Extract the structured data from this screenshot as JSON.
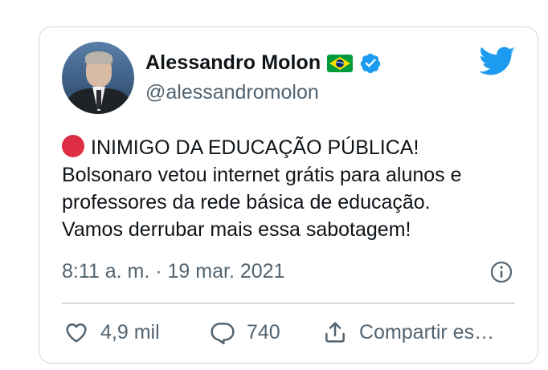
{
  "tweet": {
    "author": {
      "display_name": "Alessandro Molon",
      "handle": "@alessandromolon",
      "flag": "brazil-flag-emoji",
      "verified": true
    },
    "text_lines": [
      "INIMIGO DA EDUCAÇÃO PÚBLICA!",
      "Bolsonaro vetou internet grátis para alunos e",
      "professores da rede básica de educação.",
      "Vamos derrubar mais essa sabotagem!"
    ],
    "leading_emoji": "red-circle",
    "timestamp": "8:11 a. m. · 19 mar. 2021",
    "actions": {
      "likes": "4,9 mil",
      "replies": "740",
      "share": "Compartir es…"
    }
  },
  "colors": {
    "twitter_blue": "#1d9bf0",
    "text_primary": "#0f1419",
    "text_secondary": "#536471",
    "border": "#cfd9de",
    "red_circle": "#dd2e44"
  }
}
